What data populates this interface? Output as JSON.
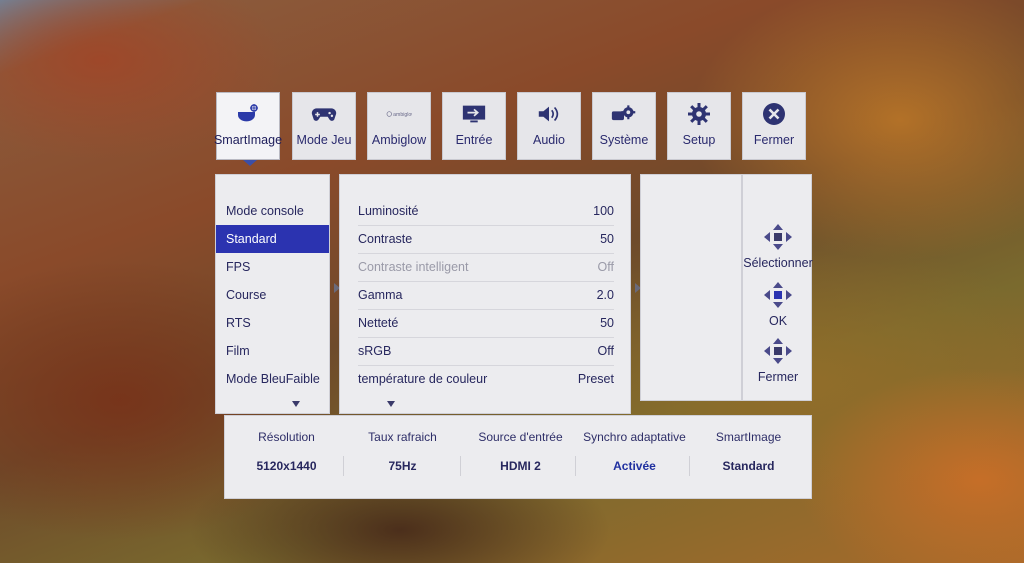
{
  "tabs": [
    {
      "label": "SmartImage",
      "icon": "smartimage-icon"
    },
    {
      "label": "Mode Jeu",
      "icon": "gamepad-icon"
    },
    {
      "label": "Ambiglow",
      "icon": "ambiglow-icon",
      "logo_text": "ambiglow"
    },
    {
      "label": "Entrée",
      "icon": "input-icon"
    },
    {
      "label": "Audio",
      "icon": "speaker-icon"
    },
    {
      "label": "Système",
      "icon": "system-gears-icon"
    },
    {
      "label": "Setup",
      "icon": "gear-icon"
    },
    {
      "label": "Fermer",
      "icon": "close-icon"
    }
  ],
  "modes": [
    "Mode console",
    "Standard",
    "FPS",
    "Course",
    "RTS",
    "Film",
    "Mode BleuFaible"
  ],
  "selected_mode": "Standard",
  "settings": [
    {
      "label": "Luminosité",
      "value": "100"
    },
    {
      "label": "Contraste",
      "value": "50"
    },
    {
      "label": "Contraste intelligent",
      "value": "Off"
    },
    {
      "label": "Gamma",
      "value": "2.0"
    },
    {
      "label": "Netteté",
      "value": "50"
    },
    {
      "label": "sRGB",
      "value": "Off"
    },
    {
      "label": "température de couleur",
      "value": "Preset"
    }
  ],
  "help": {
    "select": "Sélectionner",
    "ok": "OK",
    "close": "Fermer"
  },
  "status": {
    "headers": [
      "Résolution",
      "Taux rafraich",
      "Source d'entrée",
      "Synchro adaptative",
      "SmartImage"
    ],
    "values": [
      "5120x1440",
      "75Hz",
      "HDMI 2",
      "Activée",
      "Standard"
    ]
  },
  "colors": {
    "selection": "#2b33b0",
    "panel": "#ececef",
    "text": "#27275e"
  }
}
